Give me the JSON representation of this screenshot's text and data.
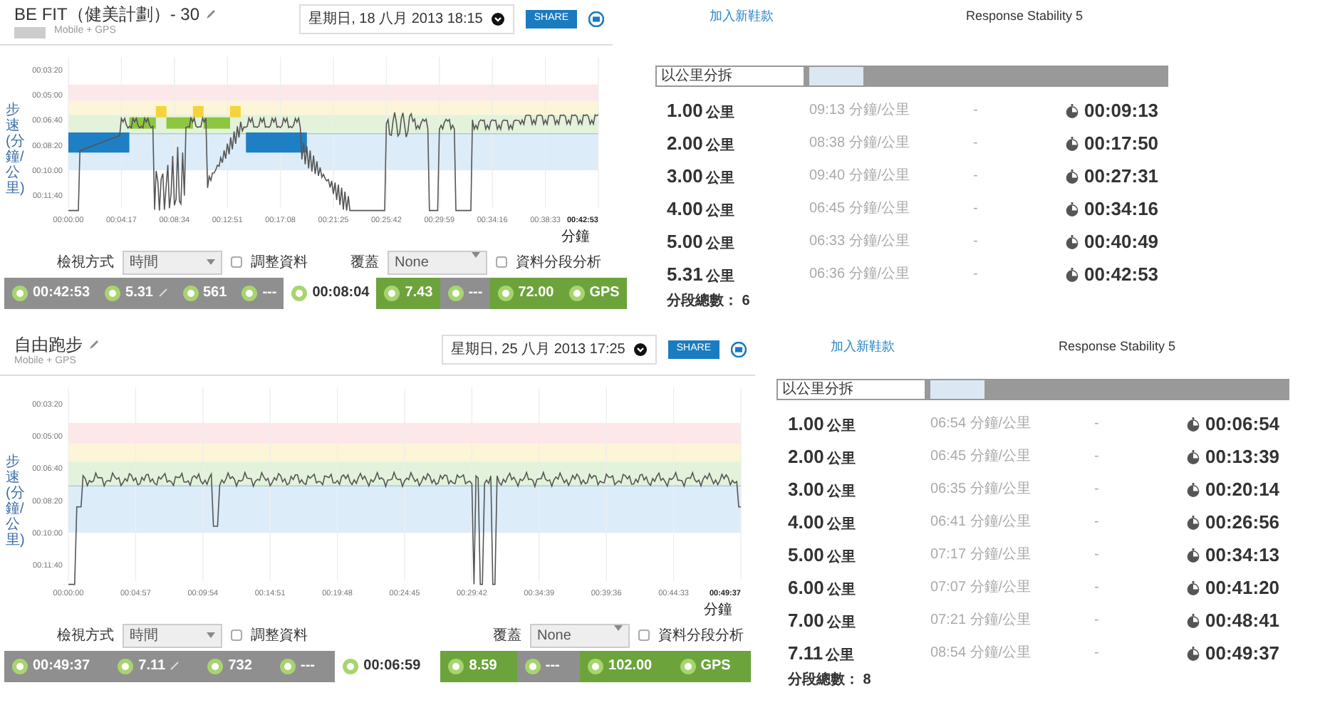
{
  "activities": [
    {
      "kind": "interval",
      "title": "BE FIT（健美計劃）- 30",
      "tagged": true,
      "subtitle": "Mobile + GPS",
      "date": "星期日, 18 八月 2013 18:15",
      "share": "SHARE",
      "y_label": "步速 (分鐘/公里)",
      "y_ticks": [
        "00:03:20",
        "00:05:00",
        "00:06:40",
        "00:08:20",
        "00:10:00",
        "00:11:40"
      ],
      "x_ticks": [
        "00:00:00",
        "00:04:17",
        "00:08:34",
        "00:12:51",
        "00:17:08",
        "00:21:25",
        "00:25:42",
        "00:29:59",
        "00:34:16",
        "00:38:33",
        "00:42:53"
      ],
      "x_unit": "分鐘",
      "view_label": "檢視方式",
      "view_value": "時間",
      "adjust_label": "調整資料",
      "adjust_checked": false,
      "overlay_label": "覆蓋",
      "overlay_value": "None",
      "split_label": "資料分段分析",
      "split_checked": false,
      "stats": [
        {
          "value": "00:42:53",
          "highlighted": false,
          "selected": false,
          "editable": false
        },
        {
          "value": "5.31",
          "highlighted": false,
          "selected": false,
          "editable": true
        },
        {
          "value": "561",
          "highlighted": false,
          "selected": false,
          "editable": false
        },
        {
          "value": "---",
          "highlighted": false,
          "selected": false,
          "editable": false
        },
        {
          "value": "00:08:04",
          "highlighted": false,
          "selected": true,
          "editable": false
        },
        {
          "value": "7.43",
          "highlighted": true,
          "selected": false,
          "editable": false
        },
        {
          "value": "---",
          "highlighted": false,
          "selected": false,
          "editable": false
        },
        {
          "value": "72.00",
          "highlighted": true,
          "selected": false,
          "editable": false
        },
        {
          "value": "GPS",
          "highlighted": true,
          "selected": false,
          "editable": false
        }
      ]
    },
    {
      "kind": "free",
      "title": "自由跑步",
      "tagged": false,
      "subtitle": "Mobile + GPS",
      "date": "星期日, 25 八月 2013 17:25",
      "share": "SHARE",
      "y_label": "步速 (分鐘/公里)",
      "y_ticks": [
        "00:03:20",
        "00:05:00",
        "00:06:40",
        "00:08:20",
        "00:10:00",
        "00:11:40"
      ],
      "x_ticks": [
        "00:00:00",
        "00:04:57",
        "00:09:54",
        "00:14:51",
        "00:19:48",
        "00:24:45",
        "00:29:42",
        "00:34:39",
        "00:39:36",
        "00:44:33",
        "00:49:37"
      ],
      "x_unit": "分鐘",
      "view_label": "檢視方式",
      "view_value": "時間",
      "adjust_label": "調整資料",
      "adjust_checked": false,
      "overlay_label": "覆蓋",
      "overlay_value": "None",
      "split_label": "資料分段分析",
      "split_checked": false,
      "stats": [
        {
          "value": "00:49:37",
          "highlighted": false,
          "selected": false,
          "editable": false
        },
        {
          "value": "7.11",
          "highlighted": false,
          "selected": false,
          "editable": true
        },
        {
          "value": "732",
          "highlighted": false,
          "selected": false,
          "editable": false
        },
        {
          "value": "---",
          "highlighted": false,
          "selected": false,
          "editable": false
        },
        {
          "value": "00:06:59",
          "highlighted": false,
          "selected": true,
          "editable": false
        },
        {
          "value": "8.59",
          "highlighted": true,
          "selected": false,
          "editable": false
        },
        {
          "value": "---",
          "highlighted": false,
          "selected": false,
          "editable": false
        },
        {
          "value": "102.00",
          "highlighted": true,
          "selected": false,
          "editable": false
        },
        {
          "value": "GPS",
          "highlighted": true,
          "selected": false,
          "editable": false
        }
      ]
    }
  ],
  "split_panels": [
    {
      "link": "加入新鞋款",
      "shoe": "Response Stability 5",
      "tabs": [
        {
          "label": "以公里分拆",
          "selected": true
        },
        {
          "selected": false
        }
      ],
      "rows": [
        {
          "distance": "1.00",
          "unit": "公里",
          "pace": "09:13 分鐘/公里",
          "dash": "-",
          "time": "00:09:13"
        },
        {
          "distance": "2.00",
          "unit": "公里",
          "pace": "08:38 分鐘/公里",
          "dash": "-",
          "time": "00:17:50"
        },
        {
          "distance": "3.00",
          "unit": "公里",
          "pace": "09:40 分鐘/公里",
          "dash": "-",
          "time": "00:27:31"
        },
        {
          "distance": "4.00",
          "unit": "公里",
          "pace": "06:45 分鐘/公里",
          "dash": "-",
          "time": "00:34:16"
        },
        {
          "distance": "5.00",
          "unit": "公里",
          "pace": "06:33 分鐘/公里",
          "dash": "-",
          "time": "00:40:49"
        },
        {
          "distance": "5.31",
          "unit": "公里",
          "pace": "06:36 分鐘/公里",
          "dash": "-",
          "time": "00:42:53"
        }
      ],
      "total_label": "分段總數：",
      "total": "6"
    },
    {
      "link": "加入新鞋款",
      "shoe": "Response Stability 5",
      "tabs": [
        {
          "label": "以公里分拆",
          "selected": true
        },
        {
          "selected": false
        }
      ],
      "rows": [
        {
          "distance": "1.00",
          "unit": "公里",
          "pace": "06:54 分鐘/公里",
          "dash": "-",
          "time": "00:06:54"
        },
        {
          "distance": "2.00",
          "unit": "公里",
          "pace": "06:45 分鐘/公里",
          "dash": "-",
          "time": "00:13:39"
        },
        {
          "distance": "3.00",
          "unit": "公里",
          "pace": "06:35 分鐘/公里",
          "dash": "-",
          "time": "00:20:14"
        },
        {
          "distance": "4.00",
          "unit": "公里",
          "pace": "06:41 分鐘/公里",
          "dash": "-",
          "time": "00:26:56"
        },
        {
          "distance": "5.00",
          "unit": "公里",
          "pace": "07:17 分鐘/公里",
          "dash": "-",
          "time": "00:34:13"
        },
        {
          "distance": "6.00",
          "unit": "公里",
          "pace": "07:07 分鐘/公里",
          "dash": "-",
          "time": "00:41:20"
        },
        {
          "distance": "7.00",
          "unit": "公里",
          "pace": "07:21 分鐘/公里",
          "dash": "-",
          "time": "00:48:41"
        },
        {
          "distance": "7.11",
          "unit": "公里",
          "pace": "08:54 分鐘/公里",
          "dash": "-",
          "time": "00:49:37"
        }
      ],
      "total_label": "分段總數：",
      "total": "8"
    }
  ]
}
